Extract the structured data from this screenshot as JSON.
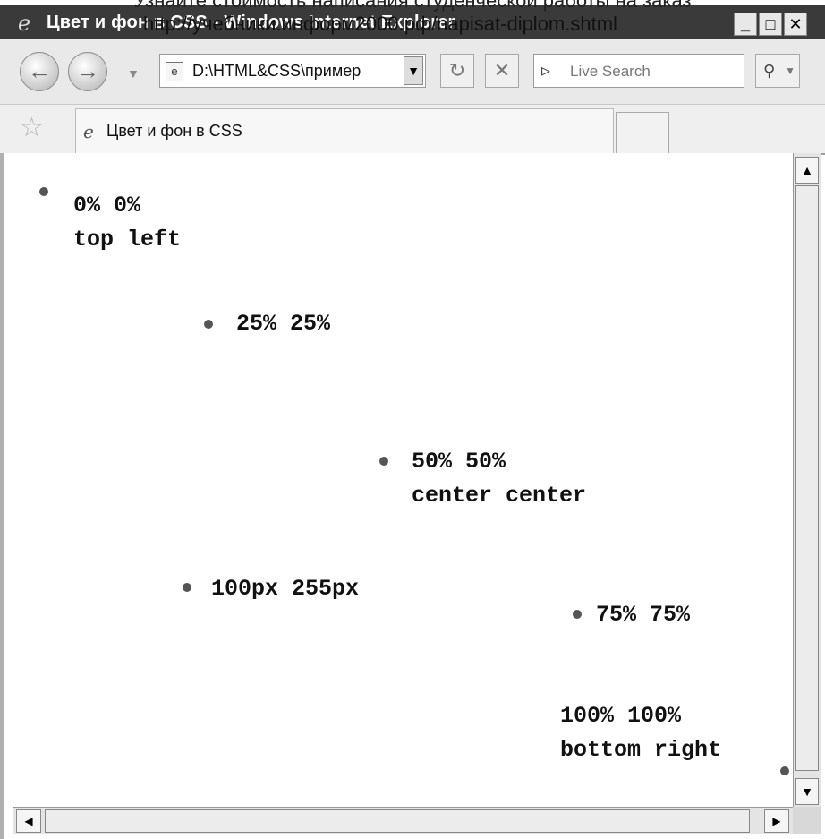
{
  "watermark": {
    "line1": "Узнайте стоимость написания студенческой работы на заказ",
    "line2": "http://учебники.информ2000.рф/napisat-diplom.shtml"
  },
  "window": {
    "title": "Цвет и фон в CSS - Windows Internet Explorer",
    "min_label": "_",
    "max_label": "□",
    "close_label": "✕"
  },
  "nav": {
    "address": "D:\\HTML&CSS\\пример",
    "search_placeholder": "Live Search"
  },
  "tab": {
    "label": "Цвет и фон в CSS"
  },
  "content": {
    "items": [
      {
        "line1": "0% 0%",
        "line2": "top left"
      },
      {
        "line1": "25% 25%",
        "line2": ""
      },
      {
        "line1": "50% 50%",
        "line2": "center center"
      },
      {
        "line1": "100px 255px",
        "line2": ""
      },
      {
        "line1": "75% 75%",
        "line2": ""
      },
      {
        "line1": "100% 100%",
        "line2": "bottom right"
      }
    ]
  },
  "icons": {
    "back": "arrow-left-icon",
    "forward": "arrow-right-icon",
    "refresh": "refresh-icon",
    "stop": "close-icon",
    "search": "magnifier-icon",
    "favorites": "star-icon"
  }
}
